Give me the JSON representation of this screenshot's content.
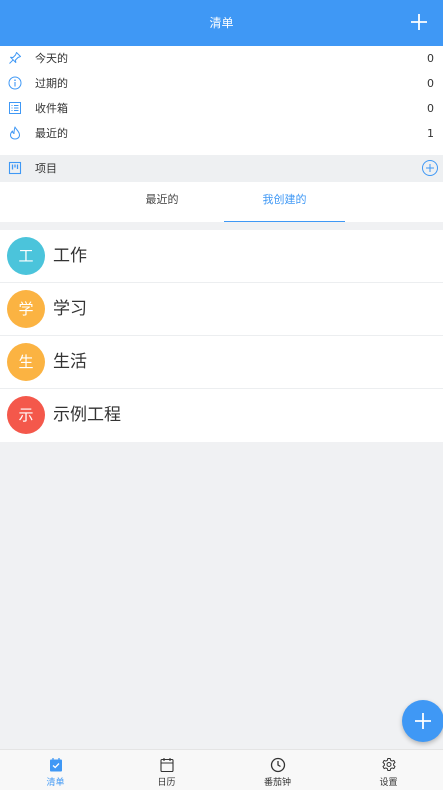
{
  "header": {
    "title": "清单"
  },
  "filters": [
    {
      "icon": "pin-icon",
      "label": "今天的",
      "count": "0"
    },
    {
      "icon": "info-icon",
      "label": "过期的",
      "count": "0"
    },
    {
      "icon": "inbox-icon",
      "label": "收件箱",
      "count": "0"
    },
    {
      "icon": "flame-icon",
      "label": "最近的",
      "count": "1"
    }
  ],
  "projects_bar": {
    "label": "项目"
  },
  "tabs": {
    "recent": "最近的",
    "created": "我创建的",
    "active": "created"
  },
  "projects": [
    {
      "initial": "工",
      "name": "工作",
      "color": "#4bc4db"
    },
    {
      "initial": "学",
      "name": "学习",
      "color": "#fbb342"
    },
    {
      "initial": "生",
      "name": "生活",
      "color": "#fbb342"
    },
    {
      "initial": "示",
      "name": "示例工程",
      "color": "#f4584b"
    }
  ],
  "bottom_nav": [
    {
      "icon": "checklist-icon",
      "label": "清单",
      "active": true
    },
    {
      "icon": "calendar-icon",
      "label": "日历",
      "active": false
    },
    {
      "icon": "clock-icon",
      "label": "番茄钟",
      "active": false
    },
    {
      "icon": "gear-icon",
      "label": "设置",
      "active": false
    }
  ],
  "colors": {
    "primary": "#3f98f5",
    "background": "#f0f1f3"
  }
}
